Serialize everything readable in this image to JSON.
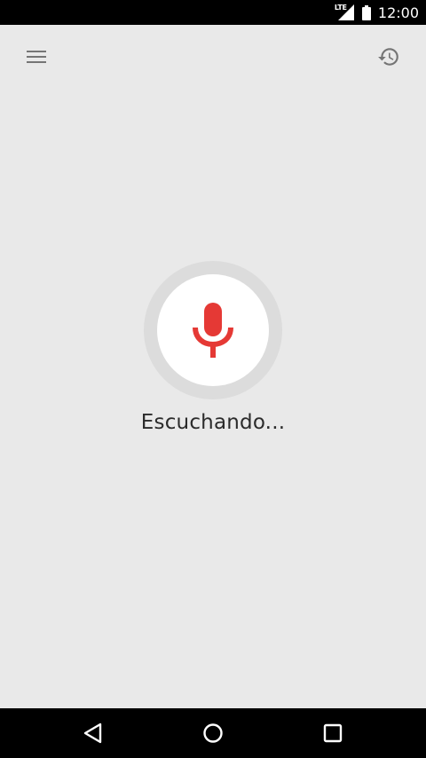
{
  "status_bar": {
    "network_label": "LTE",
    "time": "12:00"
  },
  "toolbar": {
    "menu_icon": "hamburger-menu-icon",
    "history_icon": "history-icon"
  },
  "voice": {
    "mic_icon": "microphone-icon",
    "status_text": "Escuchando..."
  },
  "nav_bar": {
    "back_icon": "back-triangle-icon",
    "home_icon": "home-circle-icon",
    "recents_icon": "recents-square-icon"
  },
  "colors": {
    "background": "#e9e9e9",
    "mic_ring": "#dcdcdc",
    "mic_accent": "#e53935",
    "text": "#2b2b2b",
    "icon": "#757575"
  }
}
